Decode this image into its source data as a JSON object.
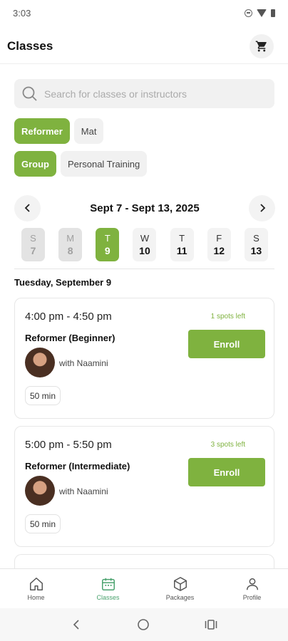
{
  "status_bar": {
    "time": "3:03"
  },
  "header": {
    "title": "Classes",
    "cart_icon": "cart-icon"
  },
  "search": {
    "placeholder": "Search for classes or instructors"
  },
  "filters": {
    "type": [
      {
        "label": "Reformer",
        "active": true
      },
      {
        "label": "Mat",
        "active": false
      }
    ],
    "format": [
      {
        "label": "Group",
        "active": true
      },
      {
        "label": "Personal Training",
        "active": false
      }
    ]
  },
  "week": {
    "range": "Sept 7 - Sept 13, 2025",
    "days": [
      {
        "letter": "S",
        "num": "7",
        "state": "past"
      },
      {
        "letter": "M",
        "num": "8",
        "state": "past"
      },
      {
        "letter": "T",
        "num": "9",
        "state": "selected"
      },
      {
        "letter": "W",
        "num": "10",
        "state": "normal"
      },
      {
        "letter": "T",
        "num": "11",
        "state": "normal"
      },
      {
        "letter": "F",
        "num": "12",
        "state": "normal"
      },
      {
        "letter": "S",
        "num": "13",
        "state": "normal"
      }
    ]
  },
  "date_heading": "Tuesday, September 9",
  "classes": [
    {
      "time": "4:00 pm - 4:50 pm",
      "spots": "1 spots left",
      "name": "Reformer (Beginner)",
      "instructor": "with Naamini",
      "duration": "50 min",
      "enroll": "Enroll"
    },
    {
      "time": "5:00 pm - 5:50 pm",
      "spots": "3 spots left",
      "name": "Reformer (Intermediate)",
      "instructor": "with Naamini",
      "duration": "50 min",
      "enroll": "Enroll"
    }
  ],
  "bottom_nav": [
    {
      "label": "Home",
      "icon": "home-icon",
      "active": false
    },
    {
      "label": "Classes",
      "icon": "calendar-icon",
      "active": true
    },
    {
      "label": "Packages",
      "icon": "box-icon",
      "active": false
    },
    {
      "label": "Profile",
      "icon": "person-icon",
      "active": false
    }
  ],
  "colors": {
    "accent": "#7fb23f",
    "nav_active": "#4aa26e"
  }
}
